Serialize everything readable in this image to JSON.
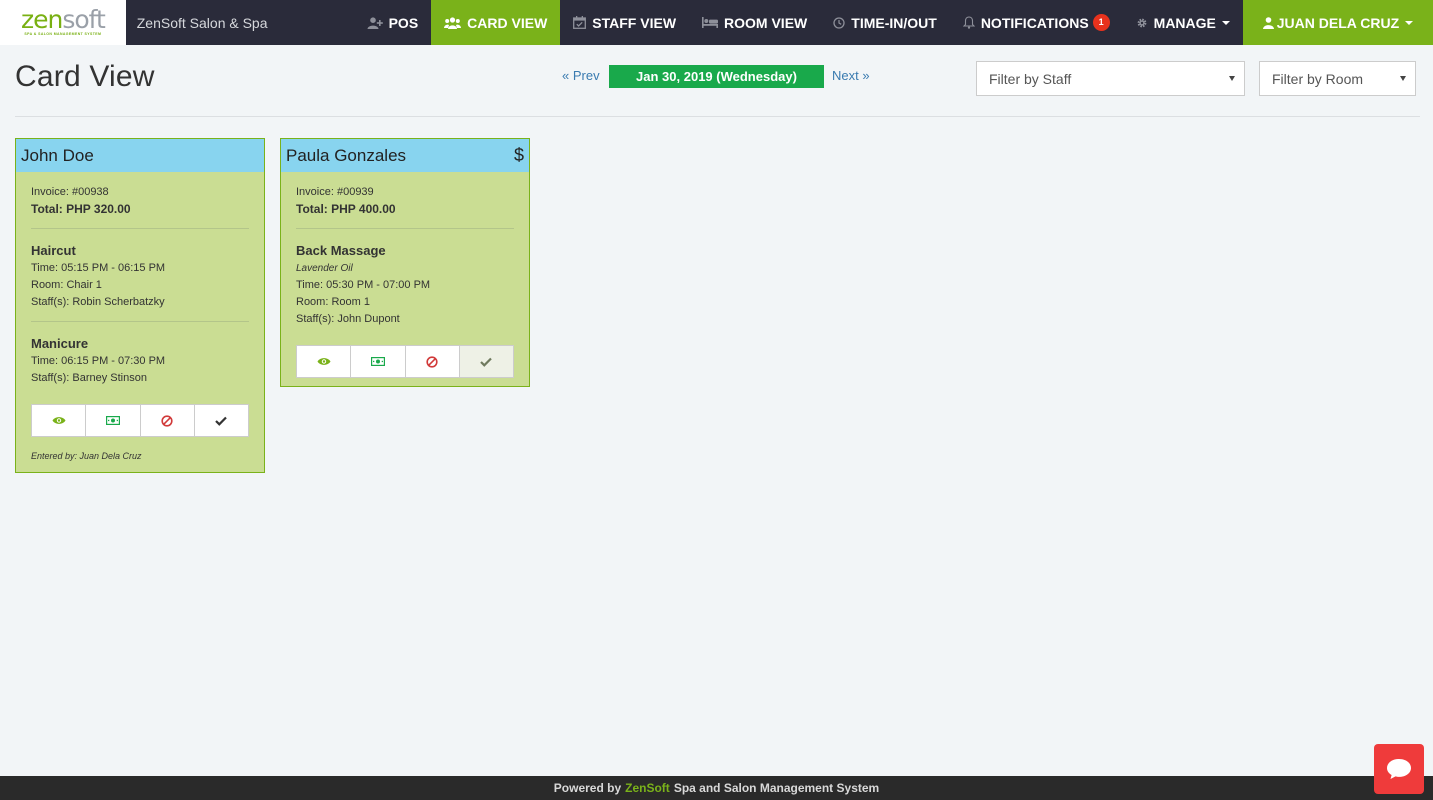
{
  "brand": {
    "word_a": "zen",
    "word_b": "soft",
    "tagline": "SPA & SALON MANAGEMENT SYSTEM",
    "site_name": "ZenSoft Salon & Spa"
  },
  "nav": {
    "pos": "POS",
    "card_view": "CARD VIEW",
    "staff_view": "STAFF VIEW",
    "room_view": "ROOM VIEW",
    "time_in_out": "TIME-IN/OUT",
    "notifications": "NOTIFICATIONS",
    "notifications_count": "1",
    "manage": "MANAGE",
    "user": "JUAN DELA CRUZ"
  },
  "header": {
    "title": "Card View",
    "prev": "« Prev",
    "date": "Jan 30, 2019 (Wednesday)",
    "next": "Next »",
    "filter_staff": "Filter by Staff",
    "filter_room": "Filter by Room"
  },
  "cards": [
    {
      "customer": "John Doe",
      "invoice": "Invoice: #00938",
      "total": "Total: PHP 320.00",
      "services": [
        {
          "name": "Haircut",
          "time": "Time: 05:15 PM - 06:15 PM",
          "room": "Room: Chair 1",
          "staff": "Staff(s): Robin Scherbatzky"
        },
        {
          "name": "Manicure",
          "time": "Time: 06:15 PM - 07:30 PM",
          "staff": "Staff(s): Barney Stinson"
        }
      ],
      "entered_by": "Entered by: Juan Dela Cruz"
    },
    {
      "customer": "Paula Gonzales",
      "paid_symbol": "$",
      "invoice": "Invoice: #00939",
      "total": "Total: PHP 400.00",
      "services": [
        {
          "name": "Back Massage",
          "note": "Lavender Oil",
          "time": "Time: 05:30 PM - 07:00 PM",
          "room": "Room: Room 1",
          "staff": "Staff(s): John Dupont"
        }
      ]
    }
  ],
  "footer": {
    "prefix": "Powered by",
    "brand": "ZenSoft",
    "suffix": "Spa and Salon Management System"
  },
  "colors": {
    "nav_bg": "#2a2b3a",
    "accent": "#7ab21a",
    "card_bg": "#cadd93",
    "card_head": "#88d4ef",
    "date_bg": "#19a94b",
    "badge": "#e8321d",
    "chat": "#ef3b3b"
  },
  "icons": [
    "user-plus-icon",
    "users-icon",
    "calendar-icon",
    "bed-icon",
    "clock-icon",
    "bell-icon",
    "gear-icon",
    "user-icon",
    "eye-icon",
    "money-icon",
    "ban-icon",
    "check-icon",
    "chat-icon"
  ]
}
